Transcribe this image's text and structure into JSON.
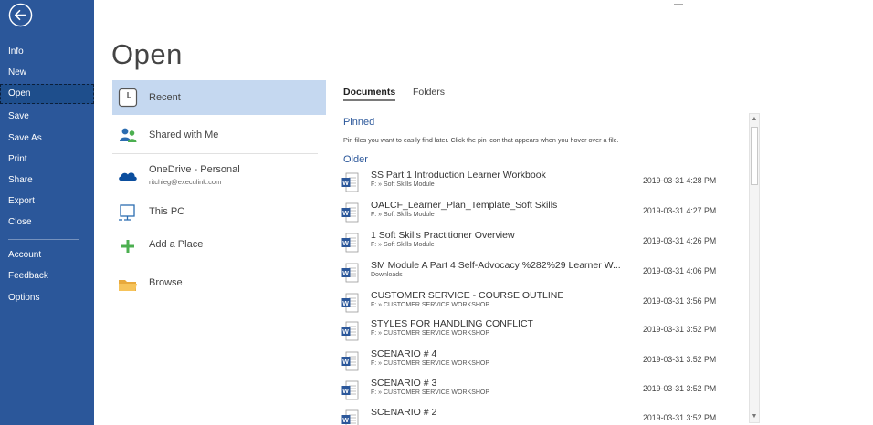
{
  "colors": {
    "sidebar": "#2b579a",
    "accent": "#2b579a",
    "selected_place": "#c5d8f0"
  },
  "sidebar": {
    "back_icon": "back-arrow-icon",
    "items": [
      {
        "label": "Info"
      },
      {
        "label": "New"
      },
      {
        "label": "Open",
        "selected": true
      },
      {
        "label": "Save"
      },
      {
        "label": "Save As"
      },
      {
        "label": "Print"
      },
      {
        "label": "Share"
      },
      {
        "label": "Export"
      },
      {
        "label": "Close"
      },
      {
        "label": "Account"
      },
      {
        "label": "Feedback"
      },
      {
        "label": "Options"
      }
    ]
  },
  "page_title": "Open",
  "places": [
    {
      "label": "Recent",
      "icon": "clock-icon",
      "selected": true
    },
    {
      "label": "Shared with Me",
      "icon": "people-icon"
    },
    {
      "label": "OneDrive - Personal",
      "sub": "ritchieg@execulink.com",
      "icon": "cloud-icon"
    },
    {
      "label": "This PC",
      "icon": "computer-icon"
    },
    {
      "label": "Add a Place",
      "icon": "plus-icon"
    },
    {
      "label": "Browse",
      "icon": "folder-icon"
    }
  ],
  "tabs": [
    {
      "label": "Documents",
      "active": true
    },
    {
      "label": "Folders"
    }
  ],
  "pinned": {
    "heading": "Pinned",
    "hint": "Pin files you want to easily find later. Click the pin icon that appears when you hover over a file."
  },
  "older": {
    "heading": "Older",
    "files": [
      {
        "name": "SS Part 1 Introduction Learner Workbook",
        "path": "F: » Soft Skills Module",
        "date": "2019-03-31 4:28 PM"
      },
      {
        "name": "OALCF_Learner_Plan_Template_Soft Skills",
        "path": "F: » Soft Skills Module",
        "date": "2019-03-31 4:27 PM"
      },
      {
        "name": "1 Soft Skills Practitioner Overview",
        "path": "F: » Soft Skills Module",
        "date": "2019-03-31 4:26 PM"
      },
      {
        "name": "SM Module A Part 4 Self-Advocacy %282%29 Learner W...",
        "path": "Downloads",
        "date": "2019-03-31 4:06 PM"
      },
      {
        "name": "CUSTOMER SERVICE - COURSE OUTLINE",
        "path": "F: » CUSTOMER SERVICE WORKSHOP",
        "date": "2019-03-31 3:56 PM"
      },
      {
        "name": "STYLES FOR HANDLING CONFLICT",
        "path": "F: » CUSTOMER SERVICE WORKSHOP",
        "date": "2019-03-31 3:52 PM"
      },
      {
        "name": "SCENARIO # 4",
        "path": "F: » CUSTOMER SERVICE WORKSHOP",
        "date": "2019-03-31 3:52 PM"
      },
      {
        "name": "SCENARIO # 3",
        "path": "F: » CUSTOMER SERVICE WORKSHOP",
        "date": "2019-03-31 3:52 PM"
      },
      {
        "name": "SCENARIO # 2",
        "path": "",
        "date": "2019-03-31 3:52 PM"
      }
    ]
  },
  "scrollbar": {
    "up_glyph": "▲",
    "down_glyph": "▼"
  }
}
